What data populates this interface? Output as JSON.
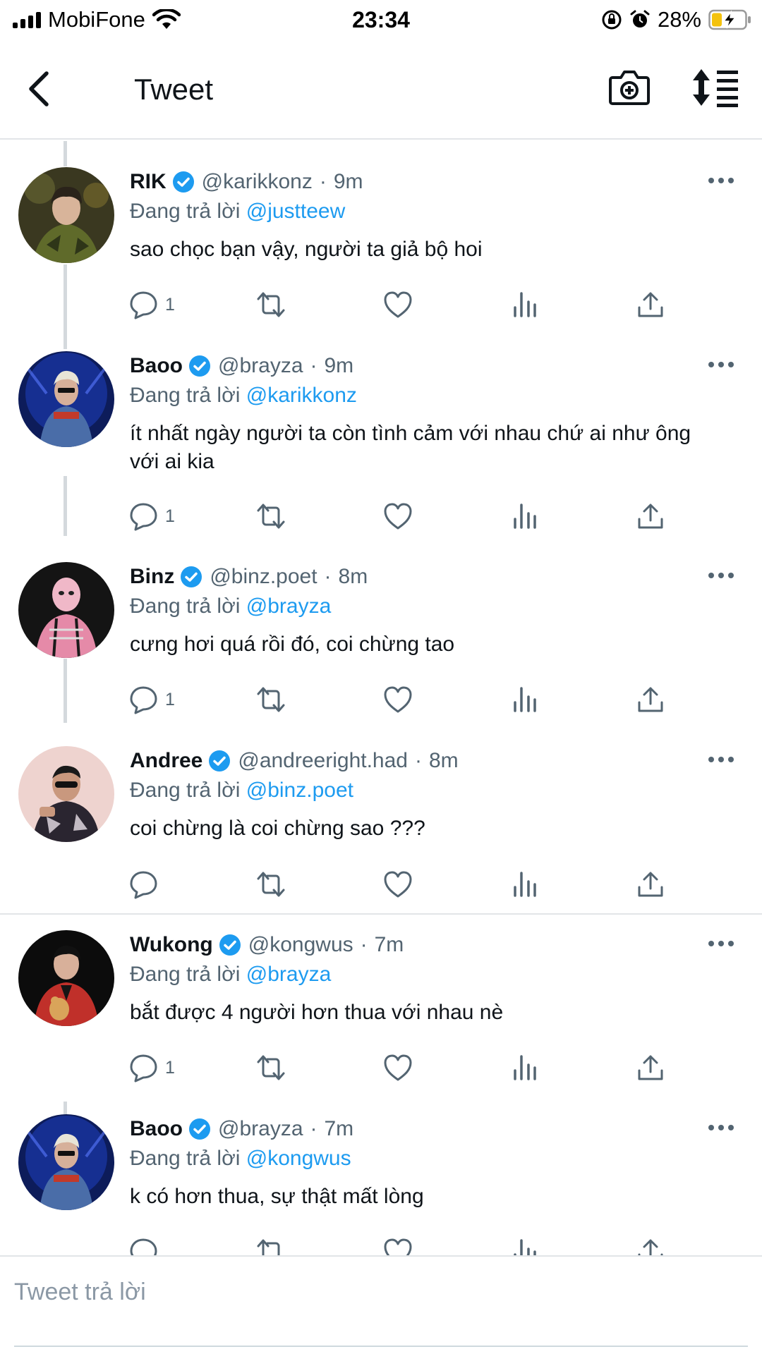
{
  "status_bar": {
    "carrier": "MobiFone",
    "time": "23:34",
    "battery": "28%"
  },
  "header": {
    "title": "Tweet"
  },
  "colors": {
    "link": "#1d9bf0",
    "secondary": "#536471",
    "verified": "#1d9bf0"
  },
  "tweets": [
    {
      "name": "RIK",
      "handle": "@karikkonz",
      "time": "9m",
      "reply_label": "Đang trả lời",
      "reply_to": "@justteew",
      "text": "sao chọc bạn vậy, người ta giả bộ hoi",
      "replies": "1",
      "avatar": "rik-avatar"
    },
    {
      "name": "Baoo",
      "handle": "@brayza",
      "time": "9m",
      "reply_label": "Đang trả lời",
      "reply_to": "@karikkonz",
      "text": "ít nhất ngày người ta còn tình cảm với nhau chứ ai như ông với ai kia",
      "replies": "1",
      "avatar": "baoo-avatar"
    },
    {
      "name": "Binz",
      "handle": "@binz.poet",
      "time": "8m",
      "reply_label": "Đang trả lời",
      "reply_to": "@brayza",
      "text": "cưng hơi quá rồi đó, coi chừng tao",
      "replies": "1",
      "avatar": "binz-avatar"
    },
    {
      "name": "Andree",
      "handle": "@andreeright.had",
      "time": "8m",
      "reply_label": "Đang trả lời",
      "reply_to": "@binz.poet",
      "text": "coi chừng là coi chừng sao ???",
      "replies": "",
      "avatar": "andree-avatar"
    },
    {
      "name": "Wukong",
      "handle": "@kongwus",
      "time": "7m",
      "reply_label": "Đang trả lời",
      "reply_to": "@brayza",
      "text": "bắt được 4 người hơn thua với nhau nè",
      "replies": "1",
      "avatar": "wukong-avatar"
    },
    {
      "name": "Baoo",
      "handle": "@brayza",
      "time": "7m",
      "reply_label": "Đang trả lời",
      "reply_to": "@kongwus",
      "text": "k có hơn thua, sự thật mất lòng",
      "replies": "",
      "avatar": "baoo-avatar"
    }
  ],
  "reply_bar": {
    "placeholder": "Tweet trả lời"
  }
}
